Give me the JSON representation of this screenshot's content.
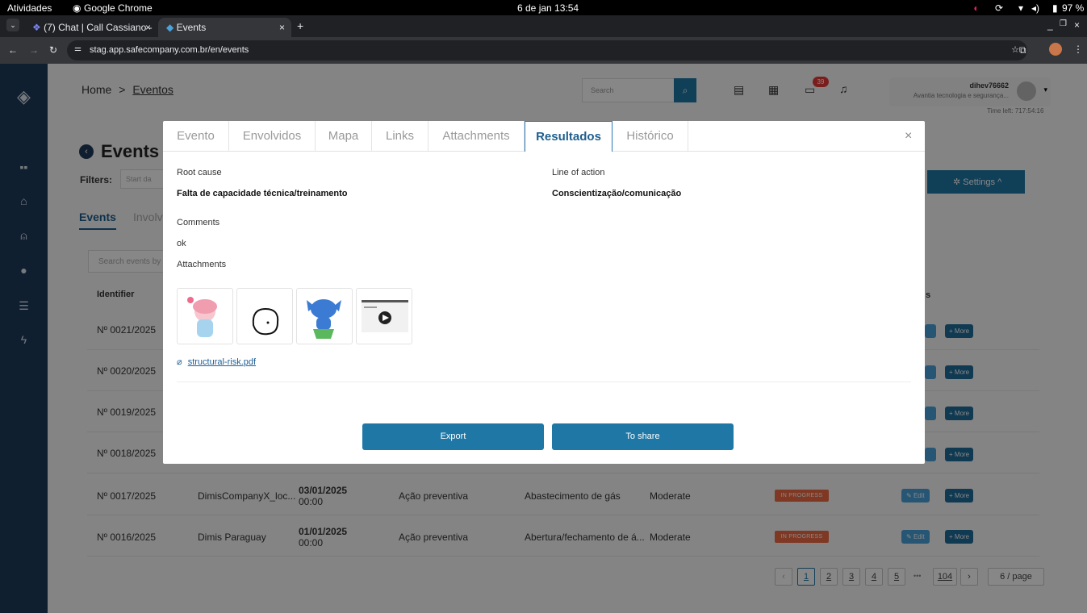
{
  "system_bar": {
    "activities": "Atividades",
    "app": "Google Chrome",
    "clock": "6 de jan  13:54",
    "battery": "97 %"
  },
  "browser": {
    "tabs": [
      {
        "label": "(7) Chat | Call Cassiano -"
      },
      {
        "label": "Events"
      }
    ],
    "url": "stag.app.safecompany.com.br/en/events"
  },
  "header": {
    "breadcrumb_home": "Home",
    "breadcrumb_sep": ">",
    "breadcrumb_current": "Eventos",
    "search_placeholder": "Search",
    "notification_count": "39",
    "user_name": "dihev76662",
    "user_company": "Avantia tecnologia e segurança...",
    "time_left": "Time left: 717:54:16"
  },
  "page": {
    "title": "Events",
    "filters_label": "Filters:",
    "start_date_placeholder": "Start da",
    "settings_label": "Settings",
    "tab_events": "Events",
    "tab_involved": "Involv",
    "search_events_placeholder": "Search events by",
    "col_identifier": "Identifier",
    "col_actions": "s"
  },
  "table": {
    "rows": [
      {
        "id": "Nº 0021/2025"
      },
      {
        "id": "Nº 0020/2025"
      },
      {
        "id": "Nº 0019/2025"
      },
      {
        "id": "Nº 0018/2025"
      },
      {
        "id": "Nº 0017/2025",
        "company": "DimisCompanyX_loc...",
        "date": "03/01/2025",
        "time": "00:00",
        "type": "Ação preventiva",
        "category": "Abastecimento de gás",
        "severity": "Moderate",
        "status": "IN PROGRESS"
      },
      {
        "id": "Nº 0016/2025",
        "company": "Dimis Paraguay",
        "date": "01/01/2025",
        "time": "00:00",
        "type": "Ação preventiva",
        "category": "Abertura/fechamento de á...",
        "severity": "Moderate",
        "status": "IN PROGRESS"
      }
    ],
    "edit_label": "Edit",
    "more_label": "More"
  },
  "pagination": {
    "pages": [
      "1",
      "2",
      "3",
      "4",
      "5"
    ],
    "ellipsis": "•••",
    "last": "104",
    "per_page": "6 / page"
  },
  "modal": {
    "tabs": [
      "Evento",
      "Envolvidos",
      "Mapa",
      "Links",
      "Attachments",
      "Resultados",
      "Histórico"
    ],
    "active_tab": "Resultados",
    "root_cause_label": "Root cause",
    "root_cause_value": "Falta de capacidade técnica/treinamento",
    "line_of_action_label": "Line of action",
    "line_of_action_value": "Conscientização/comunicação",
    "comments_label": "Comments",
    "comments_value": "ok",
    "attachments_label": "Attachments",
    "attachment_file": "structural-risk.pdf",
    "export_label": "Export",
    "share_label": "To share"
  },
  "colors": {
    "primary": "#1f77a6",
    "sidebar": "#1f3b5b",
    "status_in_progress": "#f06b42",
    "badge": "#e53935"
  }
}
